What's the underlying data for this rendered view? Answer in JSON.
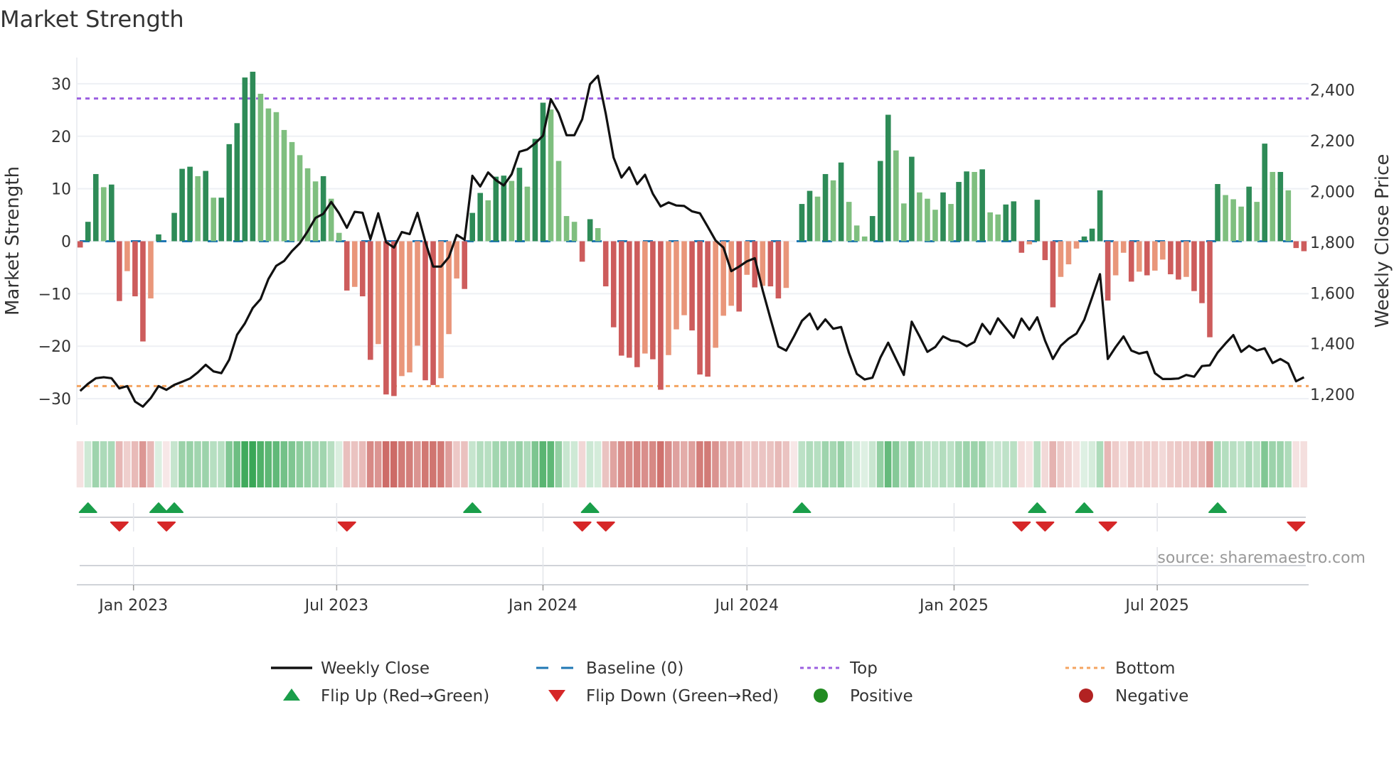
{
  "chart_data": {
    "type": "bar",
    "title": "Market Strength",
    "ylabel": "Market Strength",
    "y2label": "Weekly Close Price",
    "ylim": [
      -35,
      35
    ],
    "y2lim": [
      1080,
      2528
    ],
    "yticks": [
      30,
      20,
      10,
      0,
      -10,
      -20,
      -30
    ],
    "ytick_labels": [
      "30",
      "20",
      "10",
      "0",
      "−10",
      "−20",
      "−30"
    ],
    "y2ticks": [
      2400,
      2200,
      2000,
      1800,
      1600,
      1400,
      1200
    ],
    "y2tick_labels": [
      "2,400",
      "2,200",
      "2,000",
      "1,800",
      "1,600",
      "1,400",
      "1,200"
    ],
    "xticks": [
      {
        "week_index": 6.8,
        "label": "Jan 2023"
      },
      {
        "week_index": 32.7,
        "label": "Jul 2023"
      },
      {
        "week_index": 59.0,
        "label": "Jan 2024"
      },
      {
        "week_index": 85.0,
        "label": "Jul 2024"
      },
      {
        "week_index": 111.4,
        "label": "Jan 2025"
      },
      {
        "week_index": 137.3,
        "label": "Jul 2025"
      }
    ],
    "top_level": 27.2,
    "bottom_level": -27.6,
    "strength": [
      -1.2,
      3.7,
      12.8,
      10.3,
      10.8,
      -11.4,
      -5.7,
      -10.5,
      -19.1,
      -10.9,
      1.3,
      0,
      5.4,
      13.8,
      14.2,
      12.4,
      13.4,
      8.3,
      8.3,
      18.5,
      22.5,
      31.2,
      32.3,
      28.1,
      25.3,
      24.6,
      21.2,
      18.9,
      16.4,
      13.9,
      11.4,
      12.4,
      8.1,
      1.6,
      -9.4,
      -8.7,
      -10.5,
      -22.6,
      -19.6,
      -29.2,
      -29.5,
      -25.7,
      -25,
      -19.9,
      -26.5,
      -27.4,
      -26.1,
      -17.7,
      -7.1,
      -9.1,
      5.4,
      9.2,
      7.8,
      12.3,
      12.5,
      11.5,
      14,
      10.4,
      19.5,
      26.4,
      25.1,
      15.3,
      4.8,
      3.7,
      -3.9,
      4.2,
      2.5,
      -8.6,
      -16.4,
      -21.8,
      -22.2,
      -24,
      -21.4,
      -22.5,
      -28.3,
      -21.7,
      -16.8,
      -14.1,
      -17,
      -25.4,
      -25.8,
      -20.3,
      -14.2,
      -12.3,
      -13.4,
      -6.4,
      -8.8,
      -8.5,
      -8.6,
      -10.9,
      -8.9,
      0,
      7.1,
      9.6,
      8.5,
      12.8,
      11.6,
      15,
      7.5,
      3,
      0.9,
      4.8,
      15.3,
      24.1,
      17.3,
      7.2,
      16.1,
      9.3,
      8.1,
      6,
      9.3,
      7.1,
      11.3,
      13.3,
      13.2,
      13.7,
      5.5,
      5.1,
      7,
      7.6,
      -2.2,
      -0.6,
      7.9,
      -3.6,
      -12.6,
      -6.8,
      -4.4,
      -1.4,
      0.9,
      2.4,
      9.7,
      -11.3,
      -6.5,
      -2.2,
      -7.7,
      -5.8,
      -6.5,
      -5.6,
      -3.5,
      -6.3,
      -7.3,
      -6.8,
      -9.5,
      -11.8,
      -18.3,
      10.9,
      8.8,
      8,
      6.6,
      10.4,
      7.5,
      18.6,
      13.2,
      13.2,
      9.7,
      -1.3,
      -1.9
    ],
    "weekly_close": [
      1214,
      1242,
      1264,
      1268,
      1264,
      1224,
      1233,
      1172,
      1152,
      1186,
      1233,
      1218,
      1238,
      1250,
      1263,
      1287,
      1317,
      1291,
      1284,
      1337,
      1435,
      1480,
      1541,
      1576,
      1655,
      1707,
      1726,
      1765,
      1796,
      1843,
      1896,
      1912,
      1959,
      1914,
      1857,
      1920,
      1916,
      1812,
      1914,
      1800,
      1779,
      1840,
      1832,
      1916,
      1802,
      1704,
      1704,
      1741,
      1829,
      1810,
      2062,
      2020,
      2075,
      2045,
      2024,
      2068,
      2157,
      2166,
      2190,
      2220,
      2364,
      2309,
      2222,
      2222,
      2285,
      2423,
      2456,
      2307,
      2134,
      2055,
      2095,
      2029,
      2066,
      1991,
      1941,
      1957,
      1945,
      1943,
      1922,
      1914,
      1861,
      1807,
      1779,
      1686,
      1704,
      1725,
      1737,
      1611,
      1499,
      1389,
      1373,
      1429,
      1490,
      1519,
      1457,
      1496,
      1459,
      1466,
      1364,
      1281,
      1259,
      1266,
      1345,
      1404,
      1340,
      1277,
      1487,
      1429,
      1368,
      1387,
      1429,
      1413,
      1408,
      1390,
      1407,
      1478,
      1438,
      1500,
      1462,
      1424,
      1499,
      1455,
      1504,
      1412,
      1340,
      1392,
      1420,
      1440,
      1494,
      1583,
      1674,
      1340,
      1387,
      1429,
      1373,
      1361,
      1368,
      1284,
      1261,
      1261,
      1263,
      1277,
      1270,
      1312,
      1315,
      1365,
      1401,
      1434,
      1368,
      1392,
      1373,
      1382,
      1324,
      1340,
      1322,
      1252,
      1268
    ],
    "legend": {
      "position": "bottom",
      "entries": [
        {
          "label": "Weekly Close",
          "kind": "line"
        },
        {
          "label": "Baseline (0)",
          "kind": "dashed"
        },
        {
          "label": "Top",
          "kind": "dotted-top"
        },
        {
          "label": "Bottom",
          "kind": "dotted-bottom"
        },
        {
          "label": "Flip Up (Red→Green)",
          "kind": "tri-up"
        },
        {
          "label": "Flip Down (Green→Red)",
          "kind": "tri-down"
        },
        {
          "label": "Positive",
          "kind": "dot-pos"
        },
        {
          "label": "Negative",
          "kind": "dot-neg"
        }
      ]
    },
    "source": "source: sharemaestro.com"
  },
  "colors": {
    "pos_dark": "#2e8b57",
    "pos_light": "#7fbf7f",
    "neg_dark": "#cd5c5c",
    "neg_light": "#e9967a",
    "close": "#111111",
    "baseline": "#1f77b4",
    "top": "#9b5fe0",
    "bottom": "#f4a460",
    "flip_up": "#1a9e4a",
    "flip_down": "#d62728",
    "positive": "#228b22",
    "negative": "#b22222"
  }
}
